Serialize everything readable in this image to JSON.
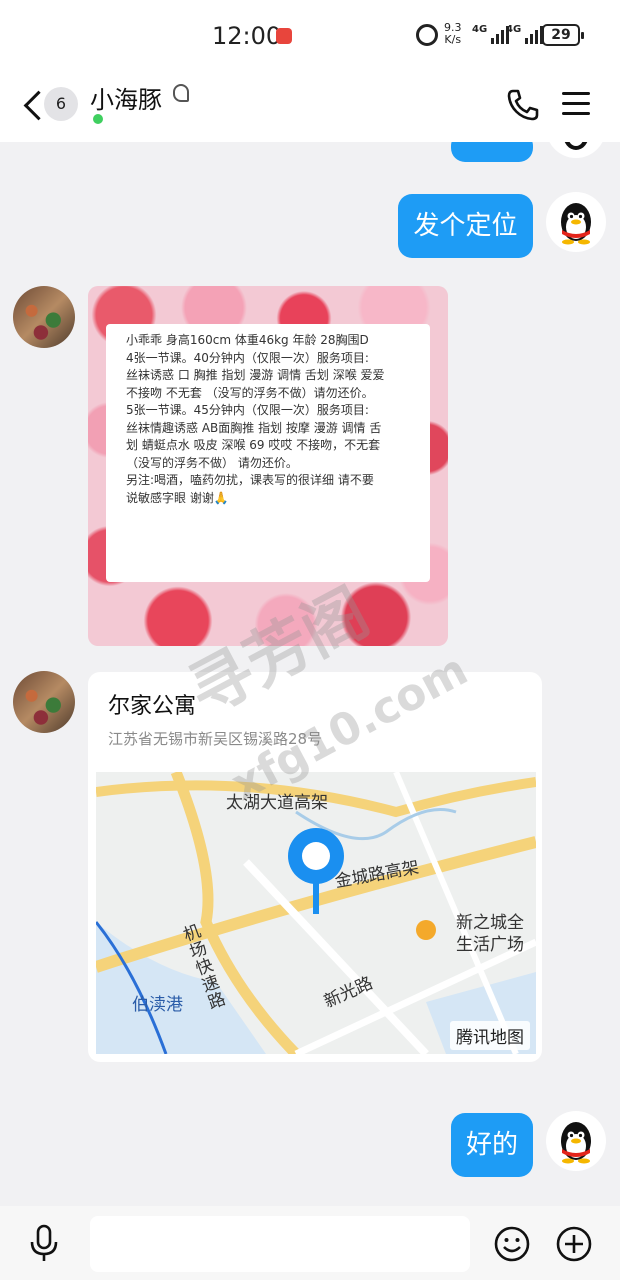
{
  "status_bar": {
    "time": "12:00",
    "net_speed_value": "9.3",
    "net_speed_unit": "K/s",
    "signal1": "4G",
    "signal2": "4G",
    "battery": "29"
  },
  "header": {
    "unread_count": "6",
    "contact_name": "小海豚",
    "online_status": ""
  },
  "messages": {
    "sent_location_request": "发个定位",
    "poster_text": "小乖乖 身高160cm 体重46kg 年龄 28胸围D\n4张一节课。40分钟内（仅限一次）服务项目:\n丝袜诱惑 口 胸推 指划 漫游 调情 舌划 深喉 爱爱\n不接吻 不无套 （没写的浮务不做）请勿还价。\n5张一节课。45分钟内（仅限一次）服务项目:\n丝袜情趣诱惑 AB面胸推 指划 按摩 漫游 调情 舌\n划 蜻蜓点水 吸皮 深喉 69 哎哎 不接吻，不无套\n（没写的浮务不做） 请勿还价。\n另注:喝酒，嗑药勿扰，课表写的很详细 请不要\n说敏感字眼 谢谢🙏",
    "location_title": "尔家公寓",
    "location_address": "江苏省无锡市新吴区锡溪路28号",
    "sent_reply": "好的"
  },
  "map": {
    "labels": {
      "road1": "太湖大道高架",
      "road2": "金城路高架",
      "road3": "机场快速路",
      "road4": "新光路",
      "area1": "伯渎港",
      "poi1_line1": "新之城全",
      "poi1_line2": "生活广场"
    },
    "brand": "腾讯地图"
  },
  "watermark": {
    "line1": "寻芳阁",
    "line2": "xfg10.com"
  },
  "input": {
    "placeholder": ""
  },
  "colors": {
    "bubble_blue": "#1e9cf5",
    "map_pin": "#1a8ff0",
    "online_green": "#3fcf5f"
  }
}
